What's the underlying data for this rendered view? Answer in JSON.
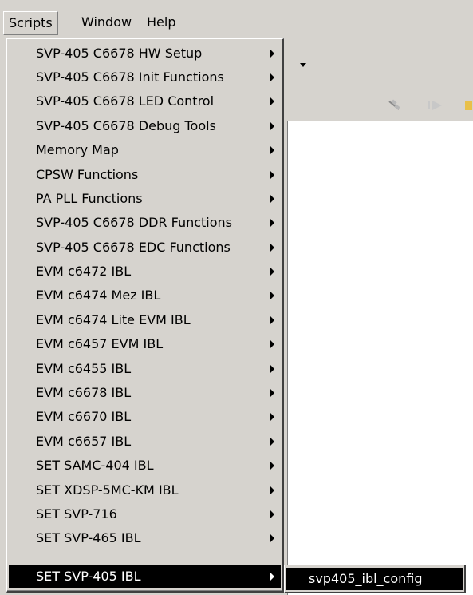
{
  "menubar": {
    "items": [
      {
        "label": "Scripts",
        "active": true
      },
      {
        "label": "Window",
        "active": false
      },
      {
        "label": "Help",
        "active": false
      }
    ]
  },
  "scripts_menu": {
    "items": [
      {
        "label": "SVP-405 C6678 HW Setup"
      },
      {
        "label": "SVP-405 C6678 Init Functions"
      },
      {
        "label": "SVP-405 C6678 LED Control"
      },
      {
        "label": "SVP-405 C6678 Debug Tools"
      },
      {
        "label": "Memory Map"
      },
      {
        "label": "CPSW Functions"
      },
      {
        "label": "PA PLL Functions"
      },
      {
        "label": "SVP-405 C6678 DDR Functions"
      },
      {
        "label": "SVP-405 C6678 EDC Functions"
      },
      {
        "label": "EVM c6472 IBL"
      },
      {
        "label": "EVM c6474 Mez IBL"
      },
      {
        "label": "EVM c6474 Lite EVM IBL"
      },
      {
        "label": "EVM c6457 EVM IBL"
      },
      {
        "label": "EVM c6455 IBL"
      },
      {
        "label": "EVM c6678 IBL"
      },
      {
        "label": "EVM c6670 IBL"
      },
      {
        "label": "EVM c6657 IBL"
      },
      {
        "label": "SET SAMC-404 IBL"
      },
      {
        "label": "SET XDSP-5MC-KM IBL"
      },
      {
        "label": "SET SVP-716"
      },
      {
        "label": "SET SVP-465 IBL"
      },
      {
        "label": "SET SVP-405 IBL",
        "highlighted": true
      }
    ]
  },
  "submenu": {
    "items": [
      {
        "label": "svp405_ibl_config",
        "highlighted": true
      }
    ]
  },
  "colors": {
    "menu_bg": "#d6d3ce",
    "highlight_bg": "#000000",
    "highlight_text": "#ffffff",
    "pane_bg": "#ffffff"
  },
  "icons": [
    "chevron-down-icon",
    "satellite-icon",
    "resume-icon",
    "terminate-icon"
  ]
}
